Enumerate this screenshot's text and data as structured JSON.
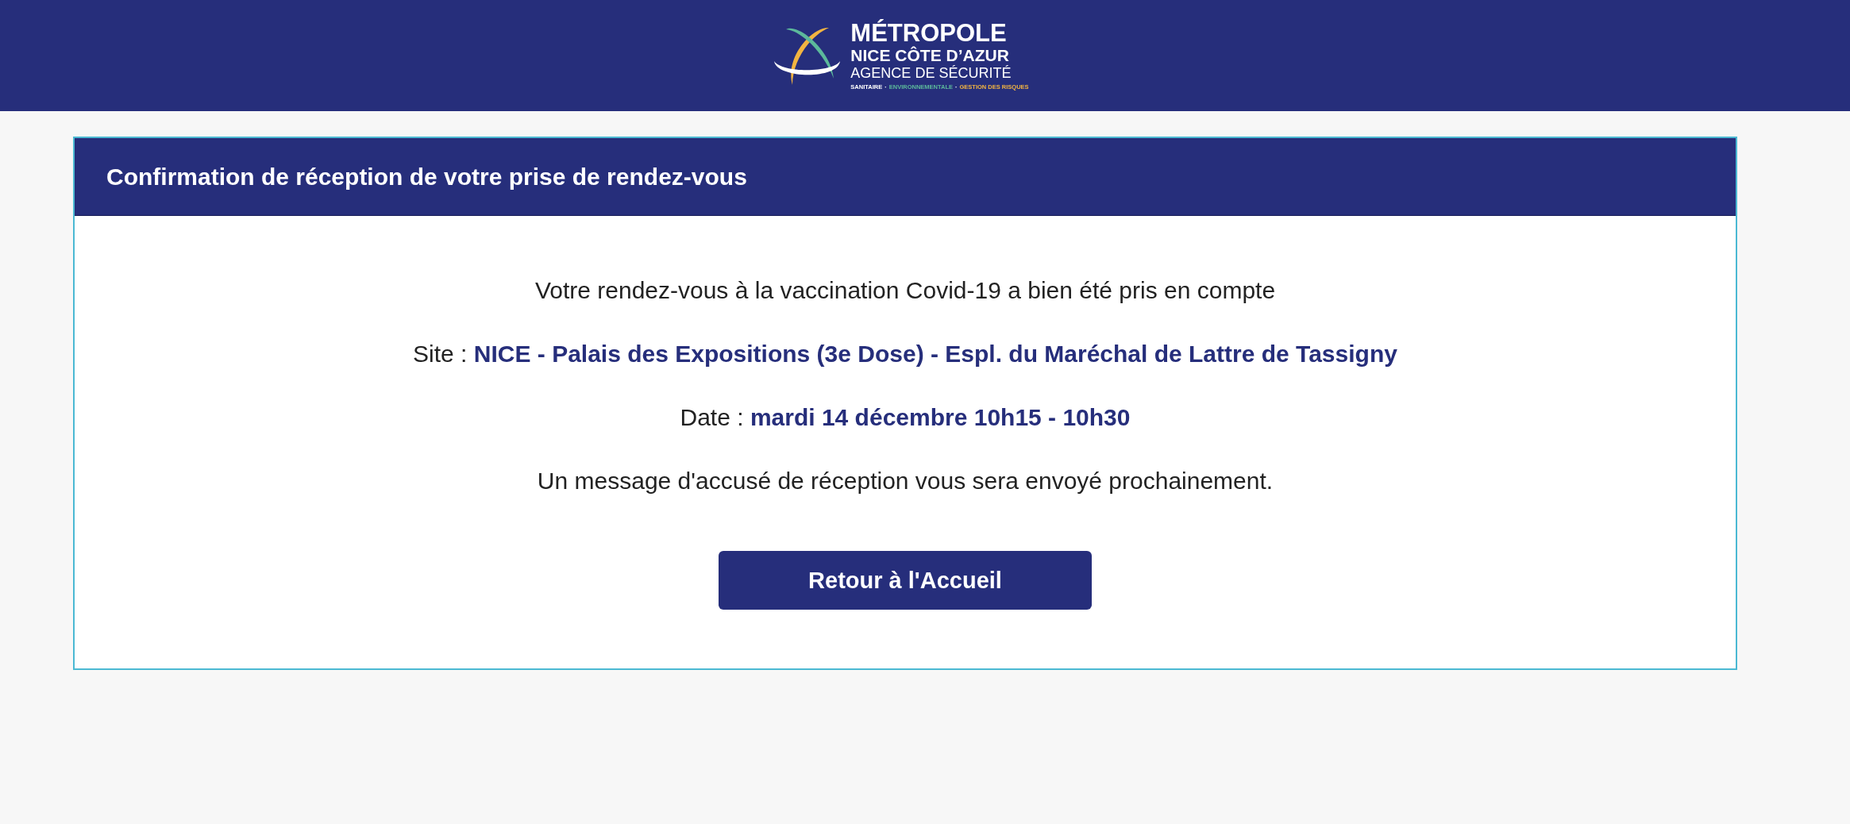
{
  "header": {
    "logo": {
      "lines": [
        {
          "kind": "title",
          "text": "MÉTROPOLE"
        },
        {
          "kind": "subtitle",
          "text": "NICE CÔTE D’AZUR"
        },
        {
          "kind": "agency",
          "text": "AGENCE DE SÉCURITÉ"
        }
      ],
      "tagline": [
        {
          "text": "SANITAIRE",
          "color": "#ffffff"
        },
        {
          "text": "ENVIRONNEMENTALE",
          "color": "#5cb99b"
        },
        {
          "text": "GESTION DES RISQUES",
          "color": "#f2b441"
        }
      ],
      "tagline_separator": "·"
    }
  },
  "card": {
    "title": "Confirmation de réception de votre prise de rendez-vous",
    "message": "Votre rendez-vous à la vaccination Covid-19 a bien été pris en compte",
    "details": [
      {
        "label": "Site :",
        "value": "NICE - Palais des Expositions (3e Dose) - Espl. du Maréchal de Lattre de Tassigny"
      },
      {
        "label": "Date :",
        "value": "mardi 14 décembre 10h15 - 10h30"
      }
    ],
    "notice": "Un message d'accusé de réception vous sera envoyé prochainement.",
    "button": "Retour à l'Accueil"
  }
}
